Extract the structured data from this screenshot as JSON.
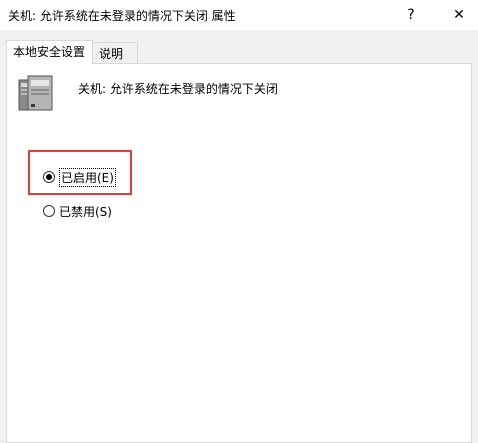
{
  "window": {
    "title": "关机: 允许系统在未登录的情况下关闭 属性",
    "help_label": "?",
    "close_label": "✕"
  },
  "tabs": [
    {
      "label": "本地安全设置",
      "active": true
    },
    {
      "label": "说明",
      "active": false
    }
  ],
  "policy": {
    "name": "关机: 允许系统在未登录的情况下关闭",
    "icon": "server-computer-icon"
  },
  "options": [
    {
      "label": "已启用(E)",
      "checked": true
    },
    {
      "label": "已禁用(S)",
      "checked": false
    }
  ],
  "annotation": {
    "highlight_color": "#e03c3c"
  }
}
